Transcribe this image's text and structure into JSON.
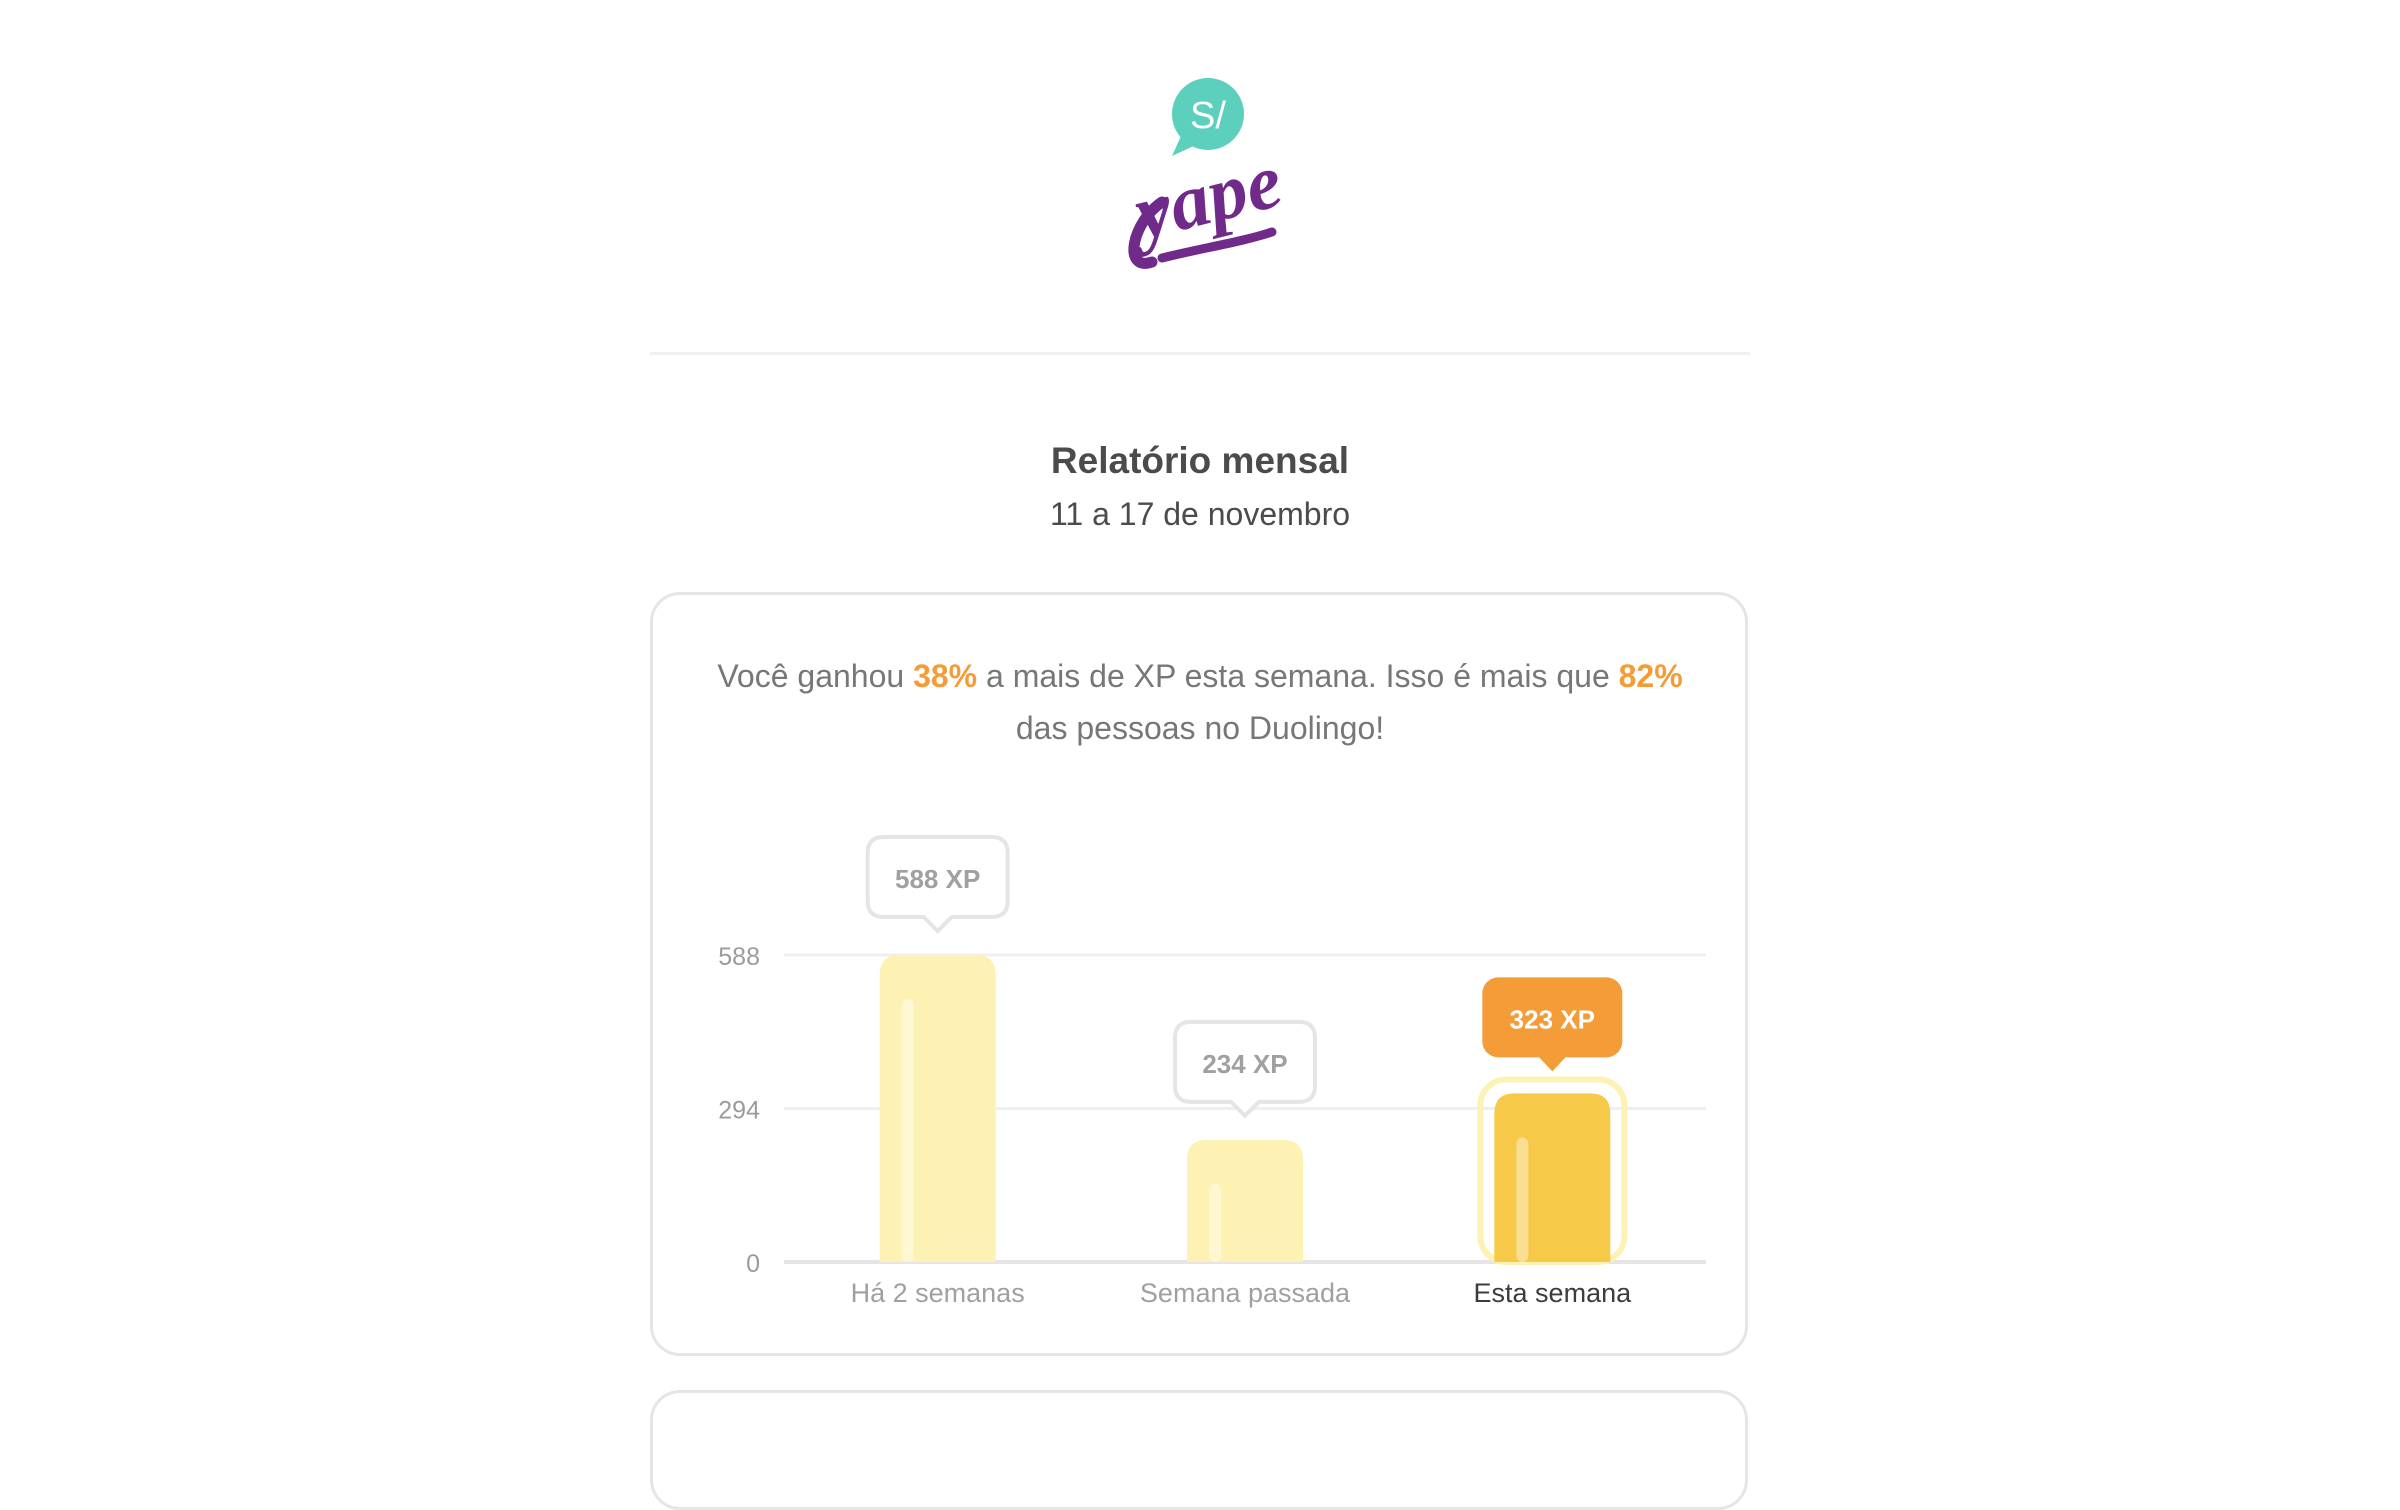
{
  "brand": {
    "logo_text": "yape",
    "badge_text": "S/"
  },
  "report": {
    "title": "Relatório mensal",
    "date_range": "11 a 17 de novembro"
  },
  "summary": {
    "prefix": "Você ganhou ",
    "pct_gain": "38%",
    "middle": " a mais de XP esta semana. Isso é mais que ",
    "pct_people": "82%",
    "suffix": " das pessoas no Duolingo!"
  },
  "colors": {
    "accent": "#f49c37",
    "bar_past": "#fdf2b4",
    "bar_current": "#f7c948",
    "text": "#4b4b4b",
    "muted": "#777777",
    "logo_purple": "#6f2a8a",
    "logo_teal": "#5ccfbd"
  },
  "chart_data": {
    "type": "bar",
    "categories": [
      "Há 2 semanas",
      "Semana passada",
      "Esta semana"
    ],
    "values": [
      588,
      234,
      323
    ],
    "value_labels": [
      "588 XP",
      "234 XP",
      "323 XP"
    ],
    "highlight_index": 2,
    "yticks": [
      0,
      294,
      588
    ],
    "ylim": [
      0,
      588
    ],
    "grid": true
  }
}
